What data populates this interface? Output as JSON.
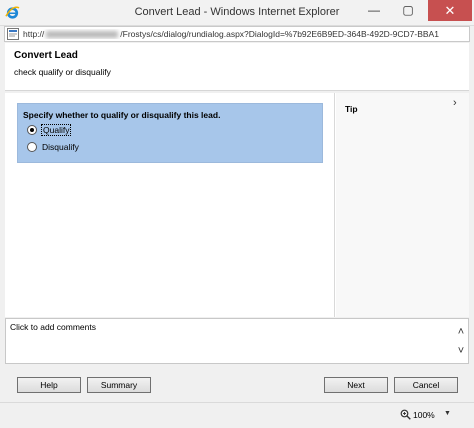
{
  "window": {
    "title": "Convert Lead - Windows Internet Explorer",
    "minimize_glyph": "—",
    "maximize_glyph": "▢",
    "close_glyph": "✕"
  },
  "address": {
    "url_prefix": "http://",
    "url_suffix": "/Frostys/cs/dialog/rundialog.aspx?DialogId=%7b92E6B9ED-364B-492D-9CD7-BBA1"
  },
  "dialog": {
    "title": "Convert Lead",
    "subtitle": "check qualify or disqualify"
  },
  "question": {
    "label": "Specify whether to qualify or disqualify this lead.",
    "options": [
      {
        "label": "Qualify",
        "selected": true
      },
      {
        "label": "Disqualify",
        "selected": false
      }
    ]
  },
  "tip": {
    "label": "Tip",
    "chevron": "›"
  },
  "comments": {
    "placeholder": "Click to add comments",
    "scroll_up": "˄",
    "scroll_down": "˅"
  },
  "buttons": {
    "help": "Help",
    "summary": "Summary",
    "next": "Next",
    "cancel": "Cancel"
  },
  "status": {
    "zoom": "100%",
    "zoom_arrow": "▼"
  },
  "colors": {
    "close_button": "#c75050",
    "question_background": "#a7c6ea"
  }
}
